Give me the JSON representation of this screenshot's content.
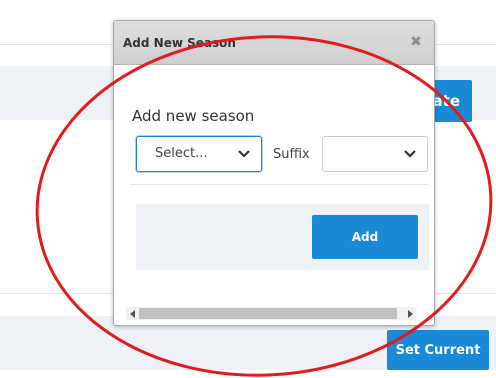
{
  "background": {
    "update_button_label": "Update",
    "set_current_button_label": "Set Current",
    "accent_color": "#1a8ad8"
  },
  "dialog": {
    "title": "Add New Season",
    "close_icon": "close-icon",
    "heading": "Add new season",
    "season_select": {
      "value": "Select...",
      "icon": "chevron-down-icon"
    },
    "suffix_label": "Suffix",
    "suffix_select": {
      "value": "",
      "icon": "chevron-down-icon"
    },
    "add_button_label": "Add"
  },
  "annotation": {
    "shape": "ellipse",
    "color": "#e31b1b"
  }
}
